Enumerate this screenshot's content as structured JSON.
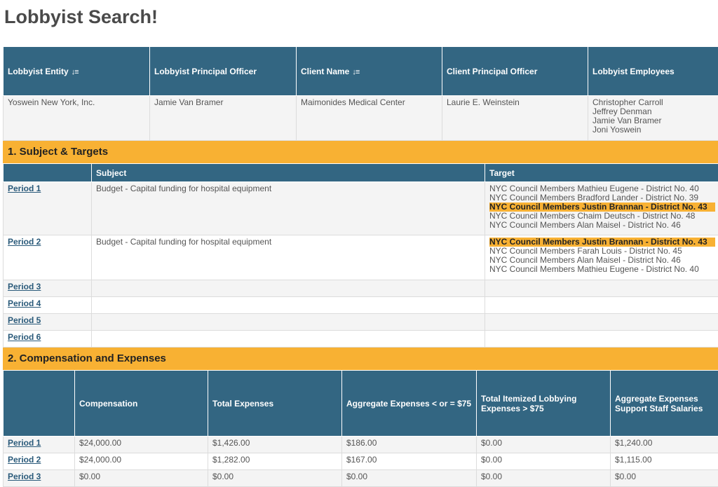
{
  "page_title": "Lobbyist Search!",
  "sort_icon": "sort-desc-icon",
  "colors": {
    "header_bg": "#336682",
    "section_bg": "#f8b133",
    "highlight": "#f8b133"
  },
  "summary": {
    "headers": [
      "Lobbyist Entity",
      "Lobbyist Principal Officer",
      "Client Name",
      "Client Principal Officer",
      "Lobbyist Employees"
    ],
    "row": {
      "entity": "Yoswein New York, Inc.",
      "principal_officer": "Jamie Van Bramer",
      "client_name": "Maimonides Medical Center",
      "client_principal_officer": "Laurie E.  Weinstein",
      "employees": [
        "Christopher Carroll",
        "Jeffrey Denman",
        "Jamie Van Bramer",
        "Joni Yoswein"
      ]
    }
  },
  "section1": {
    "title": "1. Subject & Targets",
    "headers": [
      "Subject",
      "Target"
    ],
    "rows": [
      {
        "period": "Period 1",
        "subject": "Budget - Capital funding for hospital equipment",
        "targets": [
          {
            "text": "NYC Council Members Mathieu Eugene - District No. 40",
            "hl": false
          },
          {
            "text": "NYC Council Members Bradford Lander - District No. 39",
            "hl": false
          },
          {
            "text": "NYC Council Members Justin Brannan - District No. 43",
            "hl": true
          },
          {
            "text": "NYC Council Members Chaim Deutsch - District No. 48",
            "hl": false
          },
          {
            "text": "NYC Council Members Alan Maisel - District No. 46",
            "hl": false
          }
        ]
      },
      {
        "period": "Period 2",
        "subject": "Budget - Capital funding for hospital equipment",
        "targets": [
          {
            "text": "NYC Council Members Justin Brannan - District No. 43",
            "hl": true
          },
          {
            "text": "NYC Council Members Farah Louis - District No. 45",
            "hl": false
          },
          {
            "text": "NYC Council Members Alan Maisel - District No. 46",
            "hl": false
          },
          {
            "text": "NYC Council Members Mathieu Eugene - District No. 40",
            "hl": false
          }
        ]
      },
      {
        "period": "Period 3",
        "subject": "",
        "targets": []
      },
      {
        "period": "Period 4",
        "subject": "",
        "targets": []
      },
      {
        "period": "Period 5",
        "subject": "",
        "targets": []
      },
      {
        "period": "Period 6",
        "subject": "",
        "targets": []
      }
    ]
  },
  "section2": {
    "title": "2. Compensation and Expenses",
    "headers": [
      "Compensation",
      "Total Expenses",
      "Aggregate Expenses < or = $75",
      "Total Itemized Lobbying Expenses > $75",
      "Aggregate Expenses Support Staff Salaries"
    ],
    "rows": [
      {
        "period": "Period 1",
        "values": [
          "$24,000.00",
          "$1,426.00",
          "$186.00",
          "$0.00",
          "$1,240.00"
        ]
      },
      {
        "period": "Period 2",
        "values": [
          "$24,000.00",
          "$1,282.00",
          "$167.00",
          "$0.00",
          "$1,115.00"
        ]
      },
      {
        "period": "Period 3",
        "values": [
          "$0.00",
          "$0.00",
          "$0.00",
          "$0.00",
          "$0.00"
        ]
      }
    ]
  }
}
